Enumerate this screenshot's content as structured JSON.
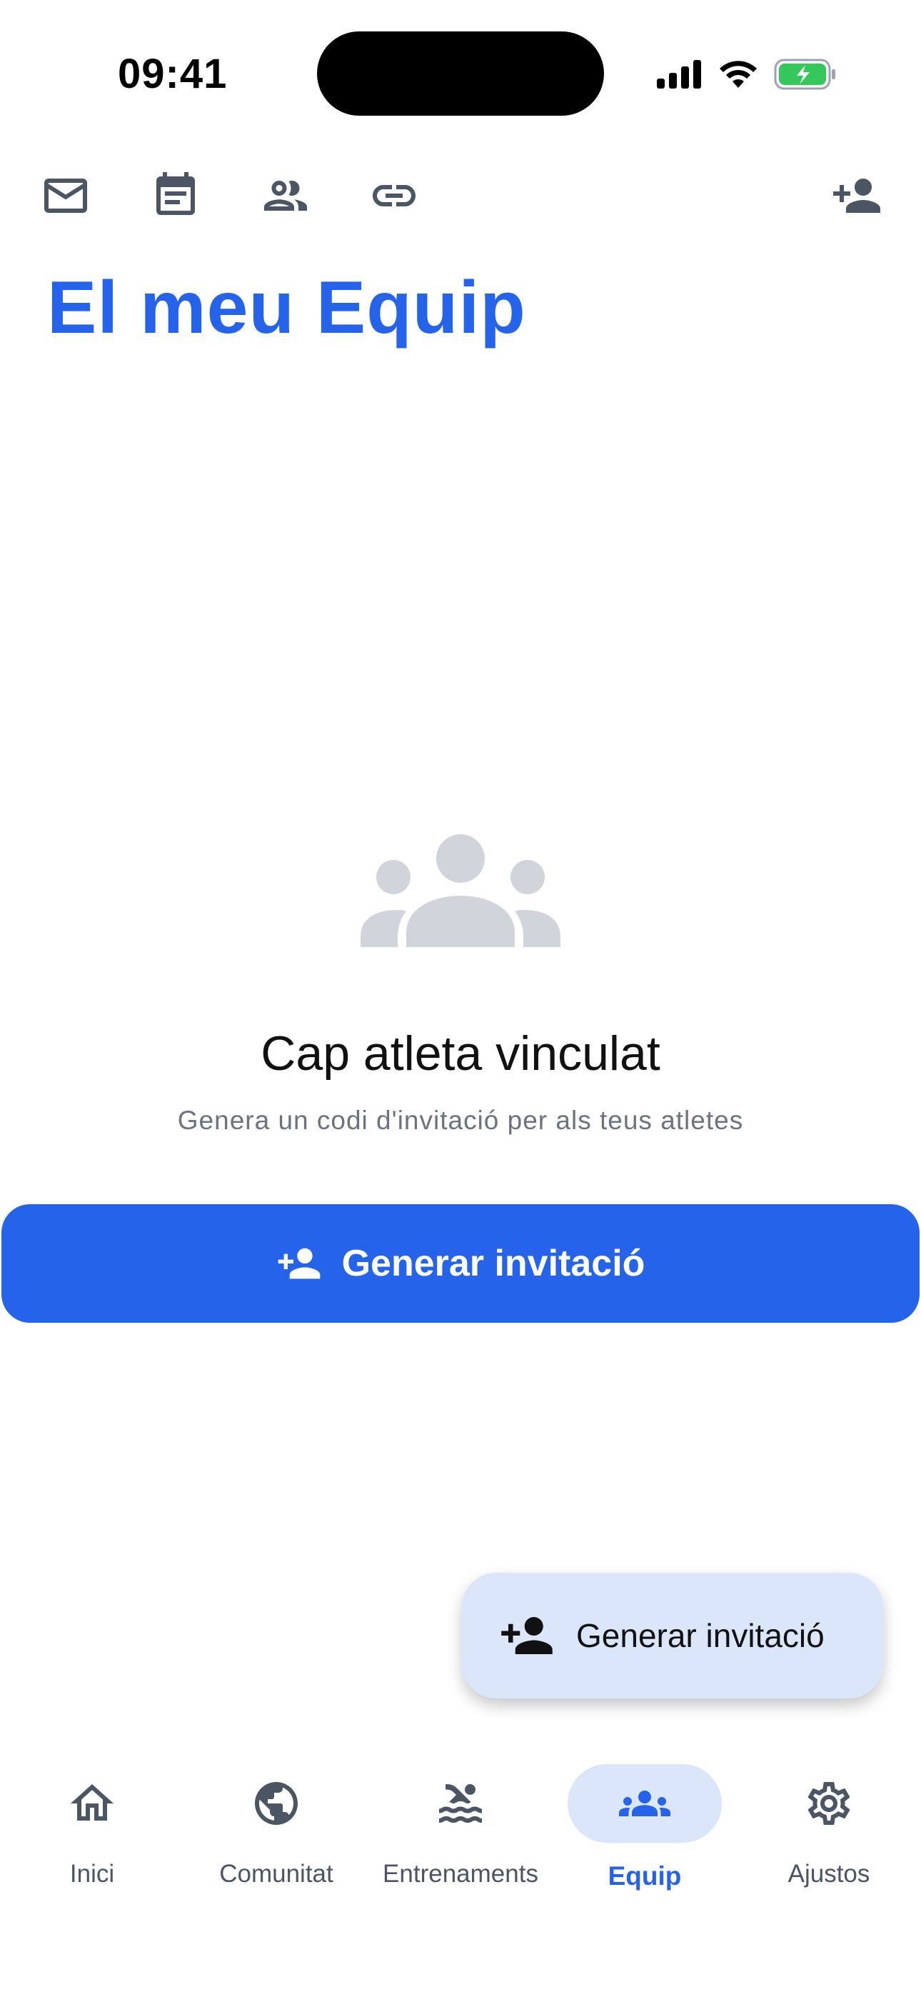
{
  "status_bar": {
    "time": "09:41",
    "battery_color": "#34c759"
  },
  "toolbar": {
    "icons": [
      "mail-icon",
      "calendar-note-icon",
      "people-icon",
      "link-icon"
    ],
    "right_icon": "add-person-icon"
  },
  "page": {
    "title": "El meu Equip"
  },
  "empty_state": {
    "icon": "groups-icon",
    "title": "Cap atleta vinculat",
    "subtitle": "Genera un codi d'invitació per als teus atletes"
  },
  "primary_button": {
    "label": "Generar invitació",
    "icon": "add-person-icon"
  },
  "fab": {
    "label": "Generar invitació",
    "icon": "add-person-icon"
  },
  "nav": {
    "items": [
      {
        "label": "Inici",
        "icon": "home-icon"
      },
      {
        "label": "Comunitat",
        "icon": "globe-icon"
      },
      {
        "label": "Entrenaments",
        "icon": "swim-icon"
      },
      {
        "label": "Equip",
        "icon": "groups-icon"
      },
      {
        "label": "Ajustos",
        "icon": "gear-icon"
      }
    ],
    "active": "Equip"
  },
  "colors": {
    "accent": "#2563eb",
    "accent_light": "#dbe6fb",
    "icon_gray": "#4b5563",
    "muted_text": "#6b7280",
    "empty_icon": "#d1d5db"
  }
}
